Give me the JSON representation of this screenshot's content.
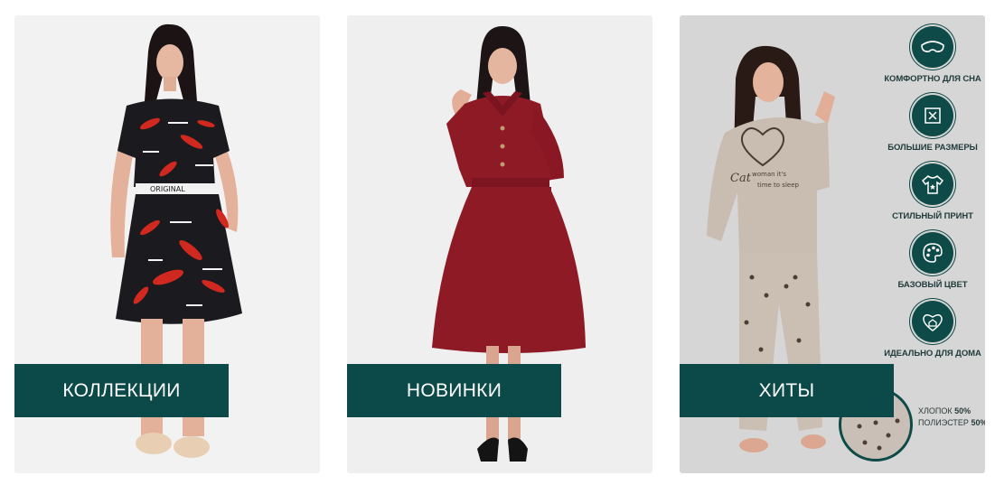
{
  "cards": [
    {
      "label": "КОЛЛЕКЦИИ"
    },
    {
      "label": "НОВИНКИ"
    },
    {
      "label": "ХИТЫ"
    }
  ],
  "features": [
    {
      "caption": "КОМФОРТНО ДЛЯ СНА",
      "icon": "sleep-mask-icon"
    },
    {
      "caption": "БОЛЬШИЕ РАЗМЕРЫ",
      "icon": "expand-arrows-icon"
    },
    {
      "caption": "СТИЛЬНЫЙ ПРИНТ",
      "icon": "tshirt-icon"
    },
    {
      "caption": "БАЗОВЫЙ ЦВЕТ",
      "icon": "palette-icon"
    },
    {
      "caption": "ИДЕАЛЬНО ДЛЯ ДОМА",
      "icon": "home-heart-icon"
    }
  ],
  "composition": {
    "cotton_label": "ХЛОПОК",
    "cotton_value": "50%",
    "polyester_label": "ПОЛИЭСТЕР",
    "polyester_value": "50%"
  },
  "colors": {
    "button_bg": "#0b4a49",
    "dress_red": "#8e1a26",
    "print_bg": "#1b1b1f",
    "pajama_beige": "#c9bdb1"
  }
}
